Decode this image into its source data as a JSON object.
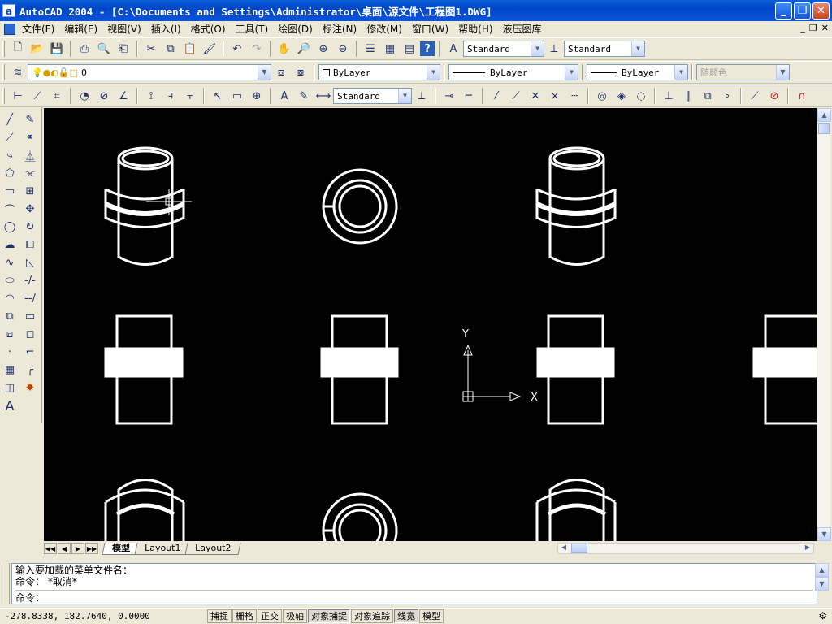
{
  "window": {
    "app_icon": "a",
    "title": "AutoCAD 2004 - [C:\\Documents and Settings\\Administrator\\桌面\\源文件\\工程图1.DWG]",
    "buttons": {
      "minimize": "_",
      "restore": "❐",
      "close": "✕"
    }
  },
  "menu": {
    "items": [
      "文件(F)",
      "编辑(E)",
      "视图(V)",
      "插入(I)",
      "格式(O)",
      "工具(T)",
      "绘图(D)",
      "标注(N)",
      "修改(M)",
      "窗口(W)",
      "帮助(H)",
      "液压图库"
    ],
    "mdi_buttons": {
      "minimize": "_",
      "restore": "❐",
      "close": "✕"
    }
  },
  "toolbar_standard": {
    "text_style": "Standard",
    "dim_style": "Standard"
  },
  "toolbar_layers": {
    "current_layer": "0",
    "color": "ByLayer",
    "linetype": "ByLayer",
    "lineweight": "ByLayer",
    "plotstyle": "随颜色"
  },
  "toolbar_dimension": {
    "dim_style": "Standard"
  },
  "icons": {
    "standard": [
      "new-icon",
      "open-icon",
      "save-icon",
      "print-icon",
      "preview-icon",
      "publish-icon",
      "cut-icon",
      "copy-icon",
      "paste-icon",
      "match-properties-icon",
      "undo-icon",
      "redo-icon",
      "pan-icon",
      "zoom-realtime-icon",
      "zoom-window-icon",
      "zoom-previous-icon",
      "properties-icon",
      "design-center-icon",
      "tool-palettes-icon",
      "help-icon"
    ],
    "draw": [
      "line-icon",
      "construction-line-icon",
      "polyline-icon",
      "polygon-icon",
      "rectangle-icon",
      "arc-icon",
      "circle-icon",
      "revision-cloud-icon",
      "spline-icon",
      "ellipse-icon",
      "ellipse-arc-icon",
      "insert-block-icon",
      "make-block-icon",
      "point-icon",
      "hatch-icon",
      "region-icon",
      "multiline-text-icon"
    ],
    "modify": [
      "erase-icon",
      "copy-object-icon",
      "mirror-icon",
      "offset-icon",
      "array-icon",
      "move-icon",
      "rotate-icon",
      "scale-icon",
      "stretch-icon",
      "trim-icon",
      "extend-icon",
      "break-icon",
      "chamfer-icon",
      "fillet-icon",
      "explode-icon"
    ],
    "dimension": [
      "linear-dim-icon",
      "aligned-dim-icon",
      "ordinate-dim-icon",
      "radius-dim-icon",
      "diameter-dim-icon",
      "angular-dim-icon",
      "quick-dim-icon",
      "baseline-dim-icon",
      "continue-dim-icon",
      "leader-icon",
      "tolerance-icon",
      "center-mark-icon",
      "dim-edit-icon",
      "dim-text-edit-icon",
      "dim-update-icon"
    ],
    "osnap": [
      "temp-track-icon",
      "snap-from-icon",
      "snap-endpoint-icon",
      "snap-midpoint-icon",
      "snap-intersection-icon",
      "snap-apparent-icon",
      "snap-extension-icon",
      "snap-center-icon",
      "snap-quadrant-icon",
      "snap-tangent-icon",
      "snap-perpendicular-icon",
      "snap-parallel-icon",
      "snap-insert-icon",
      "snap-node-icon",
      "snap-nearest-icon",
      "snap-none-icon",
      "osnap-settings-icon"
    ]
  },
  "canvas": {
    "background": "#000000",
    "ucs_x": "X",
    "ucs_y": "Y"
  },
  "layout_tabs": {
    "tabs": [
      "模型",
      "Layout1",
      "Layout2"
    ],
    "active": "模型",
    "nav": [
      "◀◀",
      "◀",
      "▶",
      "▶▶"
    ]
  },
  "command_line": {
    "lines": [
      "输入要加载的菜单文件名：",
      "命令： *取消*"
    ],
    "prompt": "命令："
  },
  "status": {
    "coords": "-278.8338, 182.7640, 0.0000",
    "toggles": [
      {
        "label": "捕捉",
        "on": false
      },
      {
        "label": "栅格",
        "on": false
      },
      {
        "label": "正交",
        "on": false
      },
      {
        "label": "极轴",
        "on": false
      },
      {
        "label": "对象捕捉",
        "on": true
      },
      {
        "label": "对象追踪",
        "on": false
      },
      {
        "label": "线宽",
        "on": true
      },
      {
        "label": "模型",
        "on": false
      }
    ]
  }
}
